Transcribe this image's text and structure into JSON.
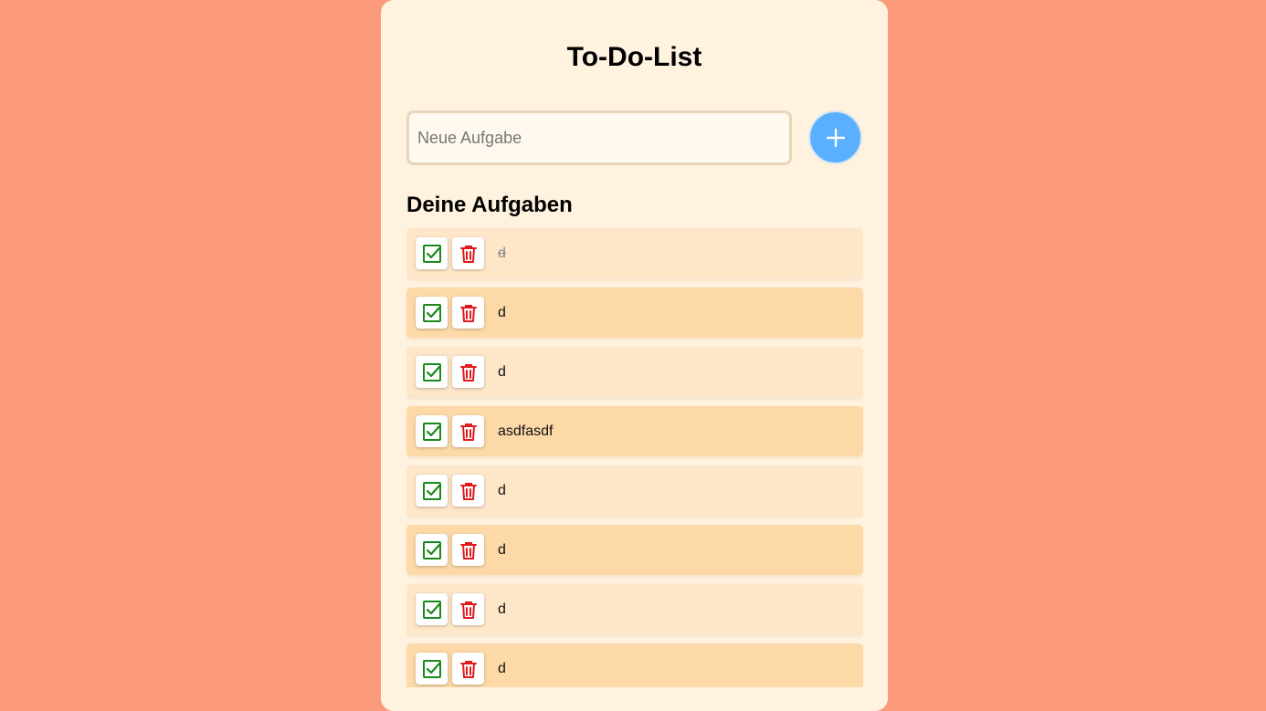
{
  "app": {
    "title": "To-Do-List"
  },
  "input": {
    "placeholder": "Neue Aufgabe",
    "value": ""
  },
  "add_button": {
    "icon": "plus-icon"
  },
  "section": {
    "heading": "Deine Aufgaben"
  },
  "tasks": [
    {
      "text": "d",
      "done": true
    },
    {
      "text": "d",
      "done": false
    },
    {
      "text": "d",
      "done": false
    },
    {
      "text": "asdfasdf",
      "done": false
    },
    {
      "text": "d",
      "done": false
    },
    {
      "text": "d",
      "done": false
    },
    {
      "text": "d",
      "done": false
    },
    {
      "text": "d",
      "done": false
    }
  ],
  "colors": {
    "background": "#fb9a7b",
    "card": "#fff2df",
    "accent": "#5aafff",
    "check": "#1a8a1a",
    "delete": "#e01b1b"
  }
}
